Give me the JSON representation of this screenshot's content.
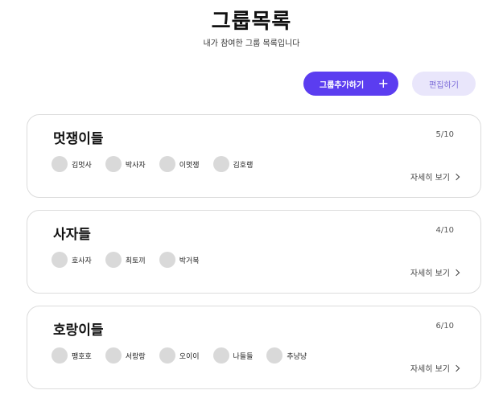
{
  "header": {
    "title": "그룹목록",
    "subtitle": "내가 참여한 그룹 목록입니다"
  },
  "actions": {
    "add_label": "그룹추가하기",
    "add_icon": "+",
    "edit_label": "편집하기"
  },
  "colors": {
    "accent": "#5b3df0",
    "accent_light": "#e9e6fb",
    "avatar": "#d9d9d9"
  },
  "detail_label": "자세히 보기",
  "groups": [
    {
      "name": "멋쟁이들",
      "count": "5/10",
      "members": [
        "김멋사",
        "박사자",
        "이멋쟁",
        "김호랭"
      ]
    },
    {
      "name": "사자들",
      "count": "4/10",
      "members": [
        "호사자",
        "최토끼",
        "박거북"
      ]
    },
    {
      "name": "호랑이들",
      "count": "6/10",
      "members": [
        "팽호호",
        "서랑랑",
        "오이이",
        "나들들",
        "추냥냥"
      ]
    }
  ]
}
